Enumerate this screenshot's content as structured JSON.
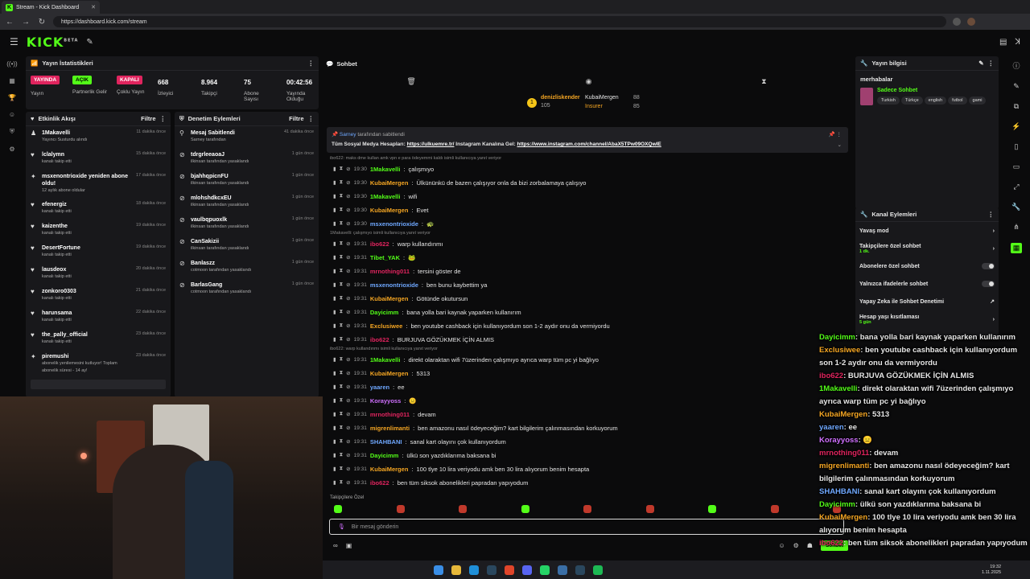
{
  "browser": {
    "tab_title": "Stream - Kick Dashboard",
    "url": "https://dashboard.kick.com/stream"
  },
  "header": {
    "logo": "KICK",
    "logo_sup": "BETA"
  },
  "stats": {
    "title": "Yayın İstatistikleri",
    "items": [
      {
        "badge": "YAYINDA",
        "badge_color": "#e0245e",
        "label": "Yayın"
      },
      {
        "badge": "AÇIK",
        "badge_color": "#53fc18",
        "label": "Partnerlik Gelir"
      },
      {
        "badge": "KAPALI",
        "badge_color": "#e0245e",
        "label": "Çoklu Yayın"
      },
      {
        "value": "668",
        "label": "İzleyici"
      },
      {
        "value": "8.964",
        "label": "Takipçi"
      },
      {
        "value": "75",
        "label": "Abone Sayısı"
      },
      {
        "value": "00:42:56",
        "label": "Yayında Olduğu"
      }
    ]
  },
  "activity": {
    "title": "Etkinlik Akışı",
    "filter": "Filtre",
    "items": [
      {
        "icon": "user-plus-icon",
        "glyph": "♟",
        "name": "1Makavelli",
        "sub": "Yayıncı Susturdu alındı",
        "time": "11 dakika önce"
      },
      {
        "icon": "heart-icon",
        "glyph": "♥",
        "name": "lclalymn",
        "sub": "kanalı takip etti",
        "time": "15 dakika önce"
      },
      {
        "icon": "star-icon",
        "glyph": "✦",
        "name": "msxenontrioxide yeniden abone oldu!",
        "sub": "12 aylık abone oldular",
        "time": "17 dakika önce"
      },
      {
        "icon": "heart-icon",
        "glyph": "♥",
        "name": "efenergiz",
        "sub": "kanalı takip etti",
        "time": "18 dakika önce"
      },
      {
        "icon": "heart-icon",
        "glyph": "♥",
        "name": "kaizenthe",
        "sub": "kanalı takip etti",
        "time": "19 dakika önce"
      },
      {
        "icon": "heart-icon",
        "glyph": "♥",
        "name": "DesertFortune",
        "sub": "kanalı takip etti",
        "time": "19 dakika önce"
      },
      {
        "icon": "heart-icon",
        "glyph": "♥",
        "name": "lausdeox",
        "sub": "kanalı takip etti",
        "time": "20 dakika önce"
      },
      {
        "icon": "heart-icon",
        "glyph": "♥",
        "name": "zonkoro0303",
        "sub": "kanalı takip etti",
        "time": "21 dakika önce"
      },
      {
        "icon": "heart-icon",
        "glyph": "♥",
        "name": "harunsama",
        "sub": "kanalı takip etti",
        "time": "22 dakika önce"
      },
      {
        "icon": "heart-icon",
        "glyph": "♥",
        "name": "the_pally_official",
        "sub": "kanalı takip etti",
        "time": "23 dakika önce"
      },
      {
        "icon": "star-icon",
        "glyph": "✦",
        "name": "piremushi",
        "sub": "abonelik yenilemesini kutluyor! Toplam abonelik süresi - 14 ay!",
        "time": "23 dakika önce"
      }
    ]
  },
  "moderation": {
    "title": "Denetim Eylemleri",
    "filter": "Filtre",
    "items": [
      {
        "icon": "pin-icon",
        "glyph": "⚲",
        "name": "Mesaj Sabitlendi",
        "sub": "Sarney tarafından",
        "time": "41 dakika önce"
      },
      {
        "icon": "ban-icon",
        "glyph": "⊘",
        "name": "tdrgrleeaoaJ",
        "sub": "ilkinsan tarafından yasaklandı",
        "time": "1 gün önce"
      },
      {
        "icon": "ban-icon",
        "glyph": "⊘",
        "name": "bjahhqpicnFU",
        "sub": "ilkinsan tarafından yasaklandı",
        "time": "1 gün önce"
      },
      {
        "icon": "ban-icon",
        "glyph": "⊘",
        "name": "mlohshdkcxEU",
        "sub": "ilkinsan tarafından yasaklandı",
        "time": "1 gün önce"
      },
      {
        "icon": "ban-icon",
        "glyph": "⊘",
        "name": "vaulbqpuoxlk",
        "sub": "ilkinsan tarafından yasaklandı",
        "time": "1 gün önce"
      },
      {
        "icon": "ban-icon",
        "glyph": "⊘",
        "name": "CanSakizii",
        "sub": "ilkinsan tarafından yasaklandı",
        "time": "1 gün önce"
      },
      {
        "icon": "ban-icon",
        "glyph": "⊘",
        "name": "Banlaszz",
        "sub": "cotmoon tarafından yasaklandı",
        "time": "1 gün önce"
      },
      {
        "icon": "ban-icon",
        "glyph": "⊘",
        "name": "BarlasGang",
        "sub": "cotmoon tarafından yasaklandı",
        "time": "1 gün önce"
      }
    ]
  },
  "chat": {
    "title": "Sohbet",
    "leaderboard": {
      "top": "denizliskender",
      "top_count": "105",
      "second": "KubaiMergen",
      "second_count": "88",
      "third": "Insurer",
      "third_count": "85"
    },
    "pinned": {
      "by": "Sarney",
      "by_suffix": "tarafından sabitlendi",
      "prefix": "Tüm Sosyal Medya Hesapları:",
      "link1": "https://ulkuemre.tr/",
      "mid": "Instagram Kanalına Gel:",
      "link2": "https://www.instagram.com/channel/AbaX5TPw09OXQwIE"
    },
    "replies": [
      {
        "text": "ibo622: maks dme kullan amk vpn e para ödeyemmi kaldı isimli kullanıcıya yanıt veriyor"
      },
      {
        "text": "1Makavelli: çalışmıyo isimli kullanıcıya yanıt veriyor"
      },
      {
        "text": "ibo622: warp kullandınmı isimli kullanıcıya yanıt veriyor"
      }
    ],
    "messages": [
      {
        "time": "19:30",
        "user": "1Makavelli",
        "color": "#53fc18",
        "text": "çalışmıyo"
      },
      {
        "time": "19:30",
        "user": "KubaiMergen",
        "color": "#f5a623",
        "text": "Ülkününkü de bazen çalışıyor onla da bizi zorbalamaya çalışıyo"
      },
      {
        "time": "19:30",
        "user": "1Makavelli",
        "color": "#53fc18",
        "text": "wifi"
      },
      {
        "time": "19:30",
        "user": "KubaiMergen",
        "color": "#f5a623",
        "text": "Evet"
      },
      {
        "time": "19:30",
        "user": "msxenontrioxide",
        "color": "#6fa8ff",
        "text": "🐢"
      },
      {
        "time": "19:31",
        "user": "ibo622",
        "color": "#e0245e",
        "text": "warp kullandınmı"
      },
      {
        "time": "19:31",
        "user": "Tibet_YAK",
        "color": "#53fc18",
        "text": "🐸"
      },
      {
        "time": "19:31",
        "user": "mrnothing011",
        "color": "#e0245e",
        "text": "tersini göster de"
      },
      {
        "time": "19:31",
        "user": "msxenontrioxide",
        "color": "#6fa8ff",
        "text": "ben bunu kaybettim ya"
      },
      {
        "time": "19:31",
        "user": "KubaiMergen",
        "color": "#f5a623",
        "text": "Götünde okutursun"
      },
      {
        "time": "19:31",
        "user": "Dayicimm",
        "color": "#53fc18",
        "text": "bana yolla bari kaynak yaparken kullanırım"
      },
      {
        "time": "19:31",
        "user": "Exclusiwee",
        "color": "#f5a623",
        "text": "ben youtube cashback için kullanıyordum son 1-2 aydır onu da vermiyordu"
      },
      {
        "time": "19:31",
        "user": "ibo622",
        "color": "#e0245e",
        "text": "BURJUVA GÖZÜKMEK İÇİN ALMIS"
      },
      {
        "time": "19:31",
        "user": "1Makavelli",
        "color": "#53fc18",
        "text": "direkt olaraktan wifi 7üzerinden çalışmıyo ayrıca warp tüm pc yi bağlıyo"
      },
      {
        "time": "19:31",
        "user": "KubaiMergen",
        "color": "#f5a623",
        "text": "5313"
      },
      {
        "time": "19:31",
        "user": "yaaren",
        "color": "#6fa8ff",
        "text": "ee"
      },
      {
        "time": "19:31",
        "user": "Korayyoss",
        "color": "#d070ff",
        "text": "😑"
      },
      {
        "time": "19:31",
        "user": "mrnothing011",
        "color": "#e0245e",
        "text": "devam"
      },
      {
        "time": "19:31",
        "user": "migrenlimanti",
        "color": "#f5a623",
        "text": "ben amazonu nasıl ödeyeceğim? kart bilgilerim çalınmasından korkuyorum"
      },
      {
        "time": "19:31",
        "user": "SHAHBANI",
        "color": "#6fa8ff",
        "text": "sanal kart olayını çok kullanıyordum"
      },
      {
        "time": "19:31",
        "user": "Dayicimm",
        "color": "#53fc18",
        "text": "ülkü son yazdıklarıma baksana bi"
      },
      {
        "time": "19:31",
        "user": "KubaiMergen",
        "color": "#f5a623",
        "text": "100 tlye 10 lira veriyodu amk ben 30 lira alıyorum benim hesapta"
      },
      {
        "time": "19:31",
        "user": "ibo622",
        "color": "#e0245e",
        "text": "ben tüm siksok abonelikleri papradan yapıyodum"
      }
    ],
    "emote_section": "Takipçilere Özel",
    "input_placeholder": "Bir mesaj gönderin",
    "send_label": "Sohbet"
  },
  "stream_info": {
    "title": "Yayın bilgisi",
    "stream_title": "merhabalar",
    "mode": "Sadece Sohbet",
    "tags": [
      "Turkish",
      "Türkçe",
      "english",
      "futbol",
      "gami"
    ]
  },
  "channel_actions": {
    "title": "Kanal Eylemleri",
    "items": [
      {
        "label": "Yavaş mod",
        "sub": "",
        "control": "chevron"
      },
      {
        "label": "Takipçilere özel sohbet",
        "sub": "1 dk.",
        "control": "chevron"
      },
      {
        "label": "Abonelere özel sohbet",
        "sub": "",
        "control": "toggle"
      },
      {
        "label": "Yalnızca ifadelerle sohbet",
        "sub": "",
        "control": "toggle"
      },
      {
        "label": "Yapay Zeka ile Sohbet Denetimi",
        "sub": "",
        "control": "link"
      },
      {
        "label": "Hesap yaşı kısıtlaması",
        "sub": "5 gün",
        "control": "chevron"
      }
    ]
  },
  "overlay": {
    "lines": [
      {
        "user": "Dayicimm",
        "color": "#53fc18",
        "text": ": bana yolla bari kaynak yaparken kullanırım"
      },
      {
        "user": "Exclusiwee",
        "color": "#f5a623",
        "text": ": ben youtube cashback için kullanıyordum son 1-2 aydır onu da vermiyordu"
      },
      {
        "user": "ibo622",
        "color": "#e0245e",
        "text": ": BURJUVA GÖZÜKMEK İÇİN ALMIS"
      },
      {
        "user": "1Makavelli",
        "color": "#53fc18",
        "text": ": direkt olaraktan wifi 7üzerinden çalışmıyo ayrıca warp tüm pc yi bağlıyo"
      },
      {
        "user": "KubaiMergen",
        "color": "#f5a623",
        "text": ": 5313"
      },
      {
        "user": "yaaren",
        "color": "#6fa8ff",
        "text": ": ee"
      },
      {
        "user": "Korayyoss",
        "color": "#d070ff",
        "text": ": 😑"
      },
      {
        "user": "mrnothing011",
        "color": "#e0245e",
        "text": ": devam"
      },
      {
        "user": "migrenlimanti",
        "color": "#f5a623",
        "text": ": ben amazonu nasıl ödeyeceğim? kart bilgilerim çalınmasından korkuyorum"
      },
      {
        "user": "SHAHBANI",
        "color": "#6fa8ff",
        "text": ": sanal kart olayını çok kullanıyordum"
      },
      {
        "user": "Dayicimm",
        "color": "#53fc18",
        "text": ": ülkü son yazdıklarıma baksana bi"
      },
      {
        "user": "KubaiMergen",
        "color": "#f5a623",
        "text": ": 100 tlye 10 lira veriyodu amk ben 30 lira alıyorum benim hesapta"
      },
      {
        "user": "ibo622",
        "color": "#e0245e",
        "text": ": ben tüm siksok abonelikleri papradan yapıyodum"
      }
    ]
  },
  "taskbar": {
    "time": "19:32",
    "date": "1.11.2025"
  }
}
